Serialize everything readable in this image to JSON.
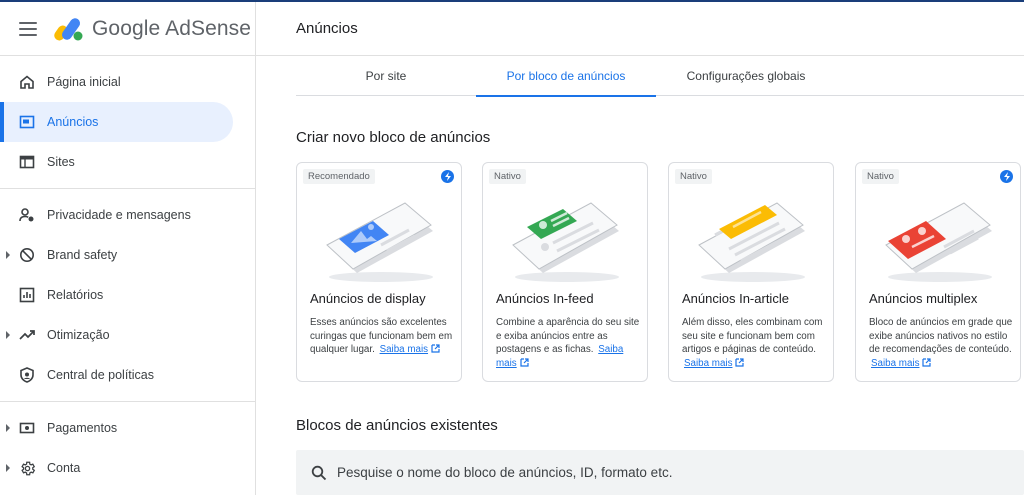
{
  "app": {
    "name": "Google AdSense"
  },
  "header": {
    "title": "Anúncios"
  },
  "sidebar": {
    "items": [
      {
        "label": "Página inicial",
        "icon": "home-icon"
      },
      {
        "label": "Anúncios",
        "icon": "ads-icon",
        "active": true
      },
      {
        "label": "Sites",
        "icon": "sites-icon"
      },
      {
        "label": "Privacidade e mensagens",
        "icon": "privacy-icon"
      },
      {
        "label": "Brand safety",
        "icon": "brand-safety-icon",
        "expandable": true
      },
      {
        "label": "Relatórios",
        "icon": "reports-icon"
      },
      {
        "label": "Otimização",
        "icon": "optimization-icon",
        "expandable": true
      },
      {
        "label": "Central de políticas",
        "icon": "policy-center-icon"
      },
      {
        "label": "Pagamentos",
        "icon": "payments-icon",
        "expandable": true
      },
      {
        "label": "Conta",
        "icon": "gear-icon",
        "expandable": true
      }
    ]
  },
  "tabs": [
    {
      "label": "Por site"
    },
    {
      "label": "Por bloco de anúncios",
      "active": true
    },
    {
      "label": "Configurações globais"
    }
  ],
  "create_section": {
    "title": "Criar novo bloco de anúncios"
  },
  "cards": [
    {
      "badge": "Recomendado",
      "title": "Anúncios de display",
      "description": "Esses anúncios são excelentes curingas que funcionam bem em qualquer lugar.",
      "link": "Saiba mais",
      "accent": "#4285f4",
      "has_bolt": true
    },
    {
      "badge": "Nativo",
      "title": "Anúncios In-feed",
      "description": "Combine a aparência do seu site e exiba anúncios entre as postagens e as fichas.",
      "link": "Saiba mais",
      "accent": "#34a853",
      "has_bolt": false
    },
    {
      "badge": "Nativo",
      "title": "Anúncios In-article",
      "description": "Além disso, eles combinam com seu site e funcionam bem com artigos e páginas de conteúdo.",
      "link": "Saiba mais",
      "accent": "#fbbc04",
      "has_bolt": false
    },
    {
      "badge": "Nativo",
      "title": "Anúncios multiplex",
      "description": "Bloco de anúncios em grade que exibe anúncios nativos no estilo de recomendações de conteúdo.",
      "link": "Saiba mais",
      "accent": "#ea4335",
      "has_bolt": true
    }
  ],
  "existing_section": {
    "title": "Blocos de anúncios existentes"
  },
  "search": {
    "placeholder": "Pesquise o nome do bloco de anúncios, ID, formato etc."
  },
  "colors": {
    "primary": "#1a73e8",
    "active_bg": "#e8f0fe",
    "border": "#dadce0"
  }
}
